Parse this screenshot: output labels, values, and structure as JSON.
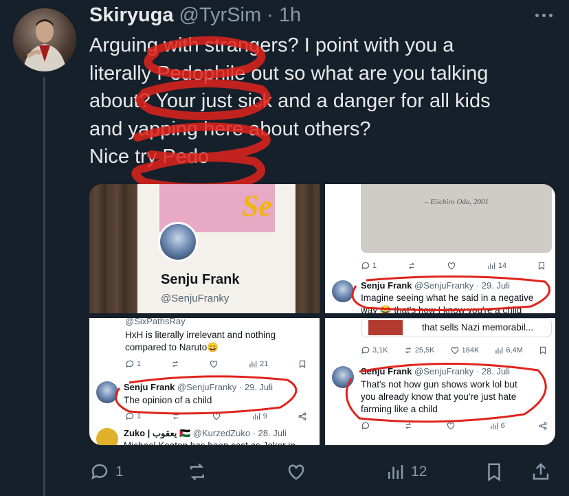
{
  "tweet": {
    "author_name": "Skiryuga",
    "handle": "@TyrSim",
    "separator": "·",
    "time": "1h",
    "text_lines": [
      "Arguing with strangers? I point with you a",
      "literally Pedophile out so what are you talking",
      "about? Your just sick and a danger for all kids",
      "and  yapping here about others?",
      "Nice try Pedo"
    ],
    "stats": {
      "replies": "1",
      "views": "12"
    }
  },
  "screens": {
    "profile": {
      "banner_text": "Se",
      "name": "Senju Frank",
      "handle": "@SenjuFranky"
    },
    "quote_top_right": {
      "book_caption": "– Eiichiro Oda, 2001",
      "actions": {
        "replies": "1",
        "views": "14"
      },
      "author": "Senju Frank",
      "handle_time": "@SenjuFranky · 29. Juli",
      "lines": [
        "Imagine seeing what he said in a negative",
        "way 😂 that's how I know you're a child"
      ]
    },
    "bottom_left": {
      "top_handle": "@SixPathsRay",
      "top_lines": [
        "HxH is literally irrelevant and nothing",
        "compared to Naruto😄"
      ],
      "top_actions": {
        "replies": "1",
        "views": "21"
      },
      "author": "Senju Frank",
      "handle_time": "@SenjuFranky · 29. Juli",
      "text": "The opinion of a child",
      "actions": {
        "replies": "1",
        "views": "9"
      },
      "next_author": "Zuko | يعقوب 🇵🇸",
      "next_handle": "@KurzedZuko · 28. Juli",
      "next_line": "Michael Keaton has been cast as Joker in"
    },
    "bottom_right": {
      "card_text": "that sells Nazi memorabil...",
      "stats": {
        "replies": "3,1K",
        "reposts": "25,5K",
        "likes": "184K",
        "views": "6,4M"
      },
      "author": "Senju Frank",
      "handle_time": "@SenjuFranky · 28. Juli",
      "lines": [
        "That's not how gun shows work lol but",
        "you already know that you're just hate",
        "farming like a child"
      ],
      "actions": {
        "views": "6"
      }
    }
  },
  "icons": {
    "more": "more-horizontal-icon",
    "reply": "reply-icon",
    "repost": "repost-icon",
    "like": "heart-icon",
    "views": "views-icon",
    "bookmark": "bookmark-icon",
    "share": "share-icon"
  },
  "colors": {
    "background": "#15202b",
    "text": "#e7e9ea",
    "muted": "#8b98a5",
    "scribble": "#e0231c"
  }
}
